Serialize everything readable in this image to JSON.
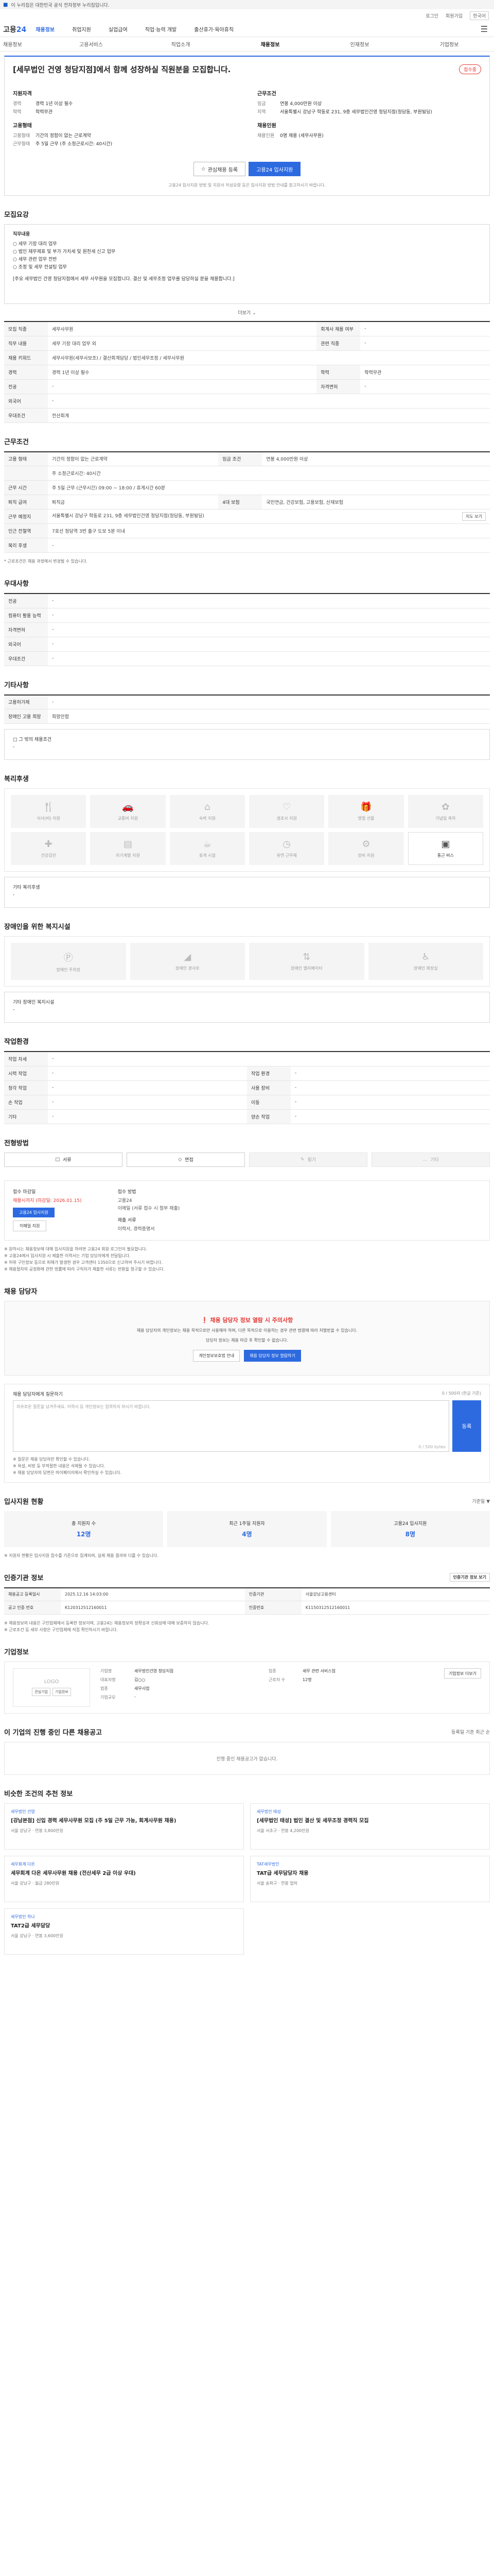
{
  "gov_banner": "이 누리집은 대한민국 공식 전자정부 누리집입니다.",
  "util": {
    "login": "로그인",
    "join": "회원가입",
    "lang": "한국어"
  },
  "logo": {
    "a": "고용",
    "b": "24"
  },
  "nav": [
    "채용정보",
    "취업지원",
    "실업급여",
    "직업·능력 개발",
    "출산휴가·육아휴직"
  ],
  "crumbs": [
    "채용정보",
    "고용서비스",
    "직업소개",
    "채용정보",
    "인재정보",
    "기업정보"
  ],
  "summary": {
    "title": "[세무법인 건영 청담지점]에서 함께 성장하실 직원분을 모집합니다.",
    "status": "접수중",
    "left_h1": "지원자격",
    "left_rows1": [
      {
        "k": "경력",
        "v": "경력 1년 이상 필수"
      },
      {
        "k": "학력",
        "v": "학력무관"
      }
    ],
    "left_h2": "고용형태",
    "left_rows2": [
      {
        "k": "고용형태",
        "v": "기간의 정함이 없는 근로계약"
      },
      {
        "k": "근무형태",
        "v": "주 5일 근무 (주 소정근로시간: 40시간)"
      }
    ],
    "right_h1": "근무조건",
    "right_rows1": [
      {
        "k": "임금",
        "v": "연봉 4,000만원 이상"
      },
      {
        "k": "지역",
        "v": "서울특별시 강남구 학동로 231, 9층 세무법인건영 청담지점(청담동, 부원빌딩)"
      }
    ],
    "right_h2": "채용인원",
    "right_rows2": [
      {
        "k": "채용인원",
        "v": "0명 채용 (세무사무원)"
      }
    ],
    "btn_bookmark": "관심채용 등록",
    "btn_apply": "고용24 입사지원",
    "note": "고용24 입사지원 방법 및 지원서 작성요령 등은 입사지원 방법 안내를 참고하시기 바랍니다."
  },
  "duty": {
    "title": "모집요강",
    "h": "직무내용",
    "lines": [
      "세무 기장 대리 업무",
      "법인 재무제표 및 부가 가치세 및 원천세 신고 업무",
      "세무 관련 업무 전반",
      "조정 및 세무 컨설팅 업무"
    ],
    "more": "[주요 세무법인 건영 청담지점에서 세무 사무원을 모집합니다. 결산 및 세무조정 업무를 담당하실 분을 채용합니다.]",
    "more_btn": "더보기"
  },
  "job_table": [
    {
      "k": "모집 직종",
      "v": "세무사무원",
      "k2": "회계사 채용 여부",
      "v2": "-"
    },
    {
      "k": "직무 내용",
      "v": "세무 기장 대리 업무 외",
      "k2": "관련 직종",
      "v2": "-"
    },
    {
      "k": "채용 키워드",
      "v": "세무사무원(세무사보조) / 결산회계담당 / 법인세무조정 / 세무사무원"
    },
    {
      "k": "경력",
      "v": "경력 1년 이상 필수",
      "k2": "학력",
      "v2": "학력무관"
    },
    {
      "k": "전공",
      "v": "-",
      "k2": "자격면허",
      "v2": "-"
    },
    {
      "k": "외국어",
      "v": "-"
    },
    {
      "k": "우대조건",
      "v": "전산회계"
    }
  ],
  "cond_title": "근무조건",
  "cond_table": [
    {
      "k": "고용 형태",
      "v": "기간의 정함이 없는 근로계약",
      "k2": "임금 조건",
      "v2": "연봉 4,000만원 이상"
    },
    {
      "k": "",
      "v": "주 소정근로시간: 40시간"
    },
    {
      "k": "근무 시간",
      "v": "주 5일 근무\n(근무시간) 09:00 ~ 18:00 / 휴게시간 60분"
    },
    {
      "k": "퇴직 급여",
      "v": "퇴직금",
      "k2": "4대 보험",
      "v2": "국민연금, 건강보험, 고용보험, 산재보험"
    },
    {
      "k": "근무 예정지",
      "v": "서울특별시 강남구 학동로 231, 9층 세무법인건영 청담지점(청담동, 부원빌딩)",
      "btn": "지도 보기"
    },
    {
      "k": "인근 전철역",
      "v": "7호선 청담역 3번 출구 도보 5분 이내"
    },
    {
      "k": "복리 후생",
      "v": "-"
    }
  ],
  "cond_note": "* 근로조건은 채용 과정에서 변경될 수 있습니다.",
  "pref_title": "우대사항",
  "pref_table": [
    {
      "k": "전공",
      "v": "-"
    },
    {
      "k": "컴퓨터 활용 능력",
      "v": "-"
    },
    {
      "k": "자격면허",
      "v": "-"
    },
    {
      "k": "외국어",
      "v": "-"
    },
    {
      "k": "우대조건",
      "v": "-"
    }
  ],
  "other_title": "기타사항",
  "other_table": [
    {
      "k": "고용허가제",
      "v": "-"
    },
    {
      "k": "장애인 고용 희망",
      "v": "희망안함"
    }
  ],
  "other_box_h": "그 밖의 채용조건",
  "other_box_v": "-",
  "welfare_title": "복리후생",
  "welfare": [
    {
      "icon": "meal-icon",
      "label": "식사(비) 지원",
      "on": false
    },
    {
      "icon": "car-icon",
      "label": "교통비 지원",
      "on": false
    },
    {
      "icon": "home-icon",
      "label": "숙박 지원",
      "on": false
    },
    {
      "icon": "heart-icon",
      "label": "경조사 지원",
      "on": false
    },
    {
      "icon": "gift-icon",
      "label": "명절 선물",
      "on": false
    },
    {
      "icon": "cake-icon",
      "label": "기념일 축하",
      "on": false
    },
    {
      "icon": "health-icon",
      "label": "건강검진",
      "on": false
    },
    {
      "icon": "book-icon",
      "label": "자기계발 지원",
      "on": false
    },
    {
      "icon": "coffee-icon",
      "label": "휴게 시설",
      "on": false
    },
    {
      "icon": "clock-icon",
      "label": "유연 근무제",
      "on": false
    },
    {
      "icon": "gear-icon",
      "label": "장비 지원",
      "on": false
    },
    {
      "icon": "bus-icon",
      "label": "통근 버스",
      "on": true
    }
  ],
  "welfare_box_h": "기타 복리후생",
  "welfare_box_v": "-",
  "disability_title": "장애인을 위한 복지시설",
  "disability": [
    {
      "icon": "parking-icon",
      "label": "장애인 주차장"
    },
    {
      "icon": "ramp-icon",
      "label": "장애인 경사로"
    },
    {
      "icon": "elevator-icon",
      "label": "장애인 엘리베이터"
    },
    {
      "icon": "toilet-icon",
      "label": "장애인 화장실"
    }
  ],
  "disability_box_h": "기타 장애인 복지시설",
  "disability_box_v": "-",
  "env_title": "작업환경",
  "env_table": [
    {
      "k": "작업 자세",
      "v": "-"
    },
    {
      "k": "시력 작업",
      "v": "-",
      "k2": "작업 환경",
      "v2": "-"
    },
    {
      "k": "청각 작업",
      "v": "-",
      "k2": "사용 장비",
      "v2": "-"
    },
    {
      "k": "손 작업",
      "v": "-",
      "k2": "이동",
      "v2": "-"
    },
    {
      "k": "기타",
      "v": "-",
      "k2": "양손 작업",
      "v2": "-"
    }
  ],
  "process_title": "전형방법",
  "process": [
    {
      "label": "서류",
      "off": false
    },
    {
      "label": "면접",
      "off": false
    },
    {
      "label": "필기",
      "off": true
    },
    {
      "label": "기타",
      "off": true
    }
  ],
  "apply": {
    "h1": "접수 마감일",
    "v1": "채용시까지 (마감일: 2026.01.15)",
    "btn1": "고용24 입사지원",
    "btn2": "이메일 지원",
    "h2": "접수 방법",
    "v2a": "고용24",
    "v2b": "이메일 (서류 접수 시 첨부 제출)",
    "h3": "제출 서류",
    "v3": "이력서, 경력증명서",
    "notes": [
      "※ 원하시는 채용정보에 대해 입사지원을 하려면 고용24 회원 로그인이 필요합니다.",
      "※ 고용24에서 입사지원 시 제출한 이력서는 기업 담당자에게 전달됩니다.",
      "※ 허위 구인정보 등으로 피해가 발생한 경우 고객센터 1350으로 신고하여 주시기 바랍니다.",
      "※ 채용절차의 공정화에 관한 법률에 따라 구직자가 제출한 서류는 반환을 청구할 수 있습니다."
    ]
  },
  "contact": {
    "title": "채용 담당자",
    "h": "채용 담당자 정보 열람 시 주의사항",
    "t1": "채용 담당자의 개인정보는 채용 목적으로만 사용해야 하며, 다른 목적으로 이용하는 경우 관련 법령에 따라 처벌받을 수 있습니다.",
    "t2": "담당자 정보는 채용 마감 후 확인할 수 없습니다.",
    "btn1": "개인정보보호법 안내",
    "btn2": "채용 담당자 정보 열람하기"
  },
  "inquiry": {
    "title": "채용 담당자에게 질문하기",
    "hint": "0 / 500자 (한글 기준)",
    "placeholder": "자유로운 질문을 남겨주세요. 이력서 등 개인정보는 입력하지 마시기 바랍니다.",
    "btn": "등록",
    "counter": "0 / 500 bytes",
    "notes": [
      "※ 질문은 채용 담당자만 확인할 수 있습니다.",
      "※ 욕설, 비방 등 부적절한 내용은 삭제될 수 있습니다.",
      "※ 채용 담당자의 답변은 마이페이지에서 확인하실 수 있습니다."
    ]
  },
  "stats": {
    "title": "입사지원 현황",
    "sub": "기준일 ▼",
    "items": [
      {
        "label": "총 지원자 수",
        "n": "12명"
      },
      {
        "label": "최근 1주일 지원자",
        "n": "4명"
      },
      {
        "label": "고용24 입사지원",
        "n": "8명"
      }
    ],
    "note": "※ 지원자 현황은 입사지원 접수를 기준으로 집계되며, 실제 채용 결과와 다를 수 있습니다."
  },
  "manage": {
    "title": "인증기관 정보",
    "btn": "인증기관 정보 보기",
    "rows": [
      {
        "k": "채용공고 등록일시",
        "v": "2025.12.16 14:03:00",
        "k2": "인증기관",
        "v2": "서울강남고용센터"
      },
      {
        "k": "공고 인증 번호",
        "v": "K120312512160011",
        "k2": "인증번호",
        "v2": "K1150312512160011"
      }
    ],
    "notes": [
      "※ 채용정보의 내용은 구인업체에서 등록한 정보이며, 고용24는 채용정보의 정확성과 신뢰성에 대해 보증하지 않습니다.",
      "※ 근로조건 등 세부 사항은 구인업체에 직접 확인하시기 바랍니다."
    ]
  },
  "company": {
    "title": "기업정보",
    "logo": "LOGO",
    "b1": "관심기업",
    "b2": "기업정보",
    "rows": [
      {
        "k": "기업명",
        "v": "세무법인건영 청담지점",
        "k2": "업종",
        "v2": "세무 관련 서비스업"
      },
      {
        "k": "대표자명",
        "v": "김○○",
        "k2": "근로자 수",
        "v2": "12명"
      },
      {
        "k": "업종",
        "v": "세무사업",
        "k2": "",
        "v2": ""
      },
      {
        "k": "기업규모",
        "v": "-",
        "k2": "",
        "v2": ""
      }
    ],
    "btn": "기업정보 더보기"
  },
  "other_jobs": {
    "title": "이 기업의 진행 중인 다른 채용공고",
    "sub": "등록일 기준 최근 순",
    "empty": "진행 중인 채용공고가 없습니다."
  },
  "similar": {
    "title": "비슷한 조건의 추천 정보",
    "cards": [
      {
        "co": "세무법인 건영",
        "title": "[강남본점] 신입 경력 세무사무원 모집 (주 5일 근무 가능, 회계사무원 채용)",
        "meta": "서울 강남구 · 연봉 3,800만원"
      },
      {
        "co": "세무법인 태성",
        "title": "[세무법인 태성] 법인 결산 및 세무조정 경력직 모집",
        "meta": "서울 서초구 · 연봉 4,200만원"
      },
      {
        "co": "세무회계 다온",
        "title": "세무회계 다온 세무사무원 채용 (전산세무 2급 이상 우대)",
        "meta": "서울 강남구 · 월급 280만원"
      },
      {
        "co": "TAT세무법인",
        "title": "TAT급 세무담당자 채용",
        "meta": "서울 송파구 · 연봉 협의"
      },
      {
        "co": "세무법인 하나",
        "title": "TAT2급 세무담당",
        "meta": "서울 강남구 · 연봉 3,600만원"
      }
    ]
  }
}
